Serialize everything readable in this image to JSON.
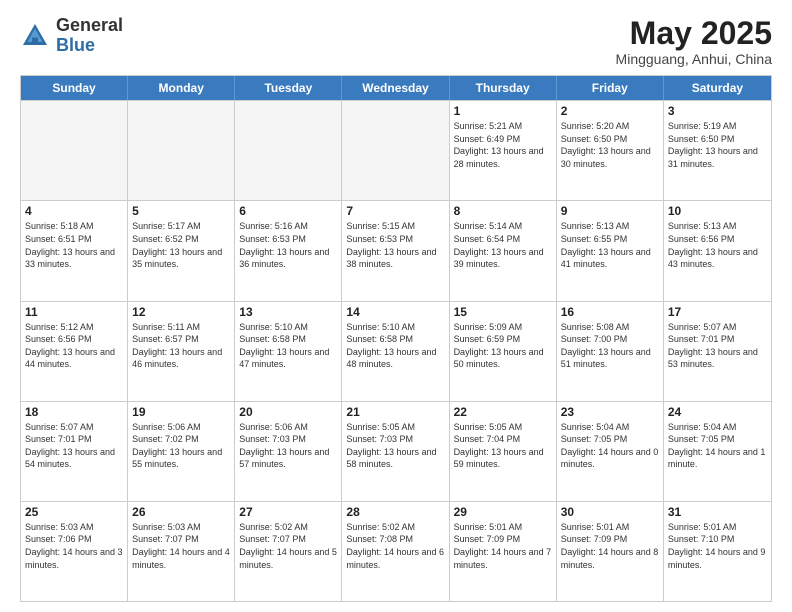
{
  "header": {
    "logo_general": "General",
    "logo_blue": "Blue",
    "month_title": "May 2025",
    "location": "Mingguang, Anhui, China"
  },
  "days_of_week": [
    "Sunday",
    "Monday",
    "Tuesday",
    "Wednesday",
    "Thursday",
    "Friday",
    "Saturday"
  ],
  "weeks": [
    [
      {
        "day": "",
        "info": "",
        "empty": true
      },
      {
        "day": "",
        "info": "",
        "empty": true
      },
      {
        "day": "",
        "info": "",
        "empty": true
      },
      {
        "day": "",
        "info": "",
        "empty": true
      },
      {
        "day": "1",
        "info": "Sunrise: 5:21 AM\nSunset: 6:49 PM\nDaylight: 13 hours\nand 28 minutes.",
        "empty": false
      },
      {
        "day": "2",
        "info": "Sunrise: 5:20 AM\nSunset: 6:50 PM\nDaylight: 13 hours\nand 30 minutes.",
        "empty": false
      },
      {
        "day": "3",
        "info": "Sunrise: 5:19 AM\nSunset: 6:50 PM\nDaylight: 13 hours\nand 31 minutes.",
        "empty": false
      }
    ],
    [
      {
        "day": "4",
        "info": "Sunrise: 5:18 AM\nSunset: 6:51 PM\nDaylight: 13 hours\nand 33 minutes.",
        "empty": false
      },
      {
        "day": "5",
        "info": "Sunrise: 5:17 AM\nSunset: 6:52 PM\nDaylight: 13 hours\nand 35 minutes.",
        "empty": false
      },
      {
        "day": "6",
        "info": "Sunrise: 5:16 AM\nSunset: 6:53 PM\nDaylight: 13 hours\nand 36 minutes.",
        "empty": false
      },
      {
        "day": "7",
        "info": "Sunrise: 5:15 AM\nSunset: 6:53 PM\nDaylight: 13 hours\nand 38 minutes.",
        "empty": false
      },
      {
        "day": "8",
        "info": "Sunrise: 5:14 AM\nSunset: 6:54 PM\nDaylight: 13 hours\nand 39 minutes.",
        "empty": false
      },
      {
        "day": "9",
        "info": "Sunrise: 5:13 AM\nSunset: 6:55 PM\nDaylight: 13 hours\nand 41 minutes.",
        "empty": false
      },
      {
        "day": "10",
        "info": "Sunrise: 5:13 AM\nSunset: 6:56 PM\nDaylight: 13 hours\nand 43 minutes.",
        "empty": false
      }
    ],
    [
      {
        "day": "11",
        "info": "Sunrise: 5:12 AM\nSunset: 6:56 PM\nDaylight: 13 hours\nand 44 minutes.",
        "empty": false
      },
      {
        "day": "12",
        "info": "Sunrise: 5:11 AM\nSunset: 6:57 PM\nDaylight: 13 hours\nand 46 minutes.",
        "empty": false
      },
      {
        "day": "13",
        "info": "Sunrise: 5:10 AM\nSunset: 6:58 PM\nDaylight: 13 hours\nand 47 minutes.",
        "empty": false
      },
      {
        "day": "14",
        "info": "Sunrise: 5:10 AM\nSunset: 6:58 PM\nDaylight: 13 hours\nand 48 minutes.",
        "empty": false
      },
      {
        "day": "15",
        "info": "Sunrise: 5:09 AM\nSunset: 6:59 PM\nDaylight: 13 hours\nand 50 minutes.",
        "empty": false
      },
      {
        "day": "16",
        "info": "Sunrise: 5:08 AM\nSunset: 7:00 PM\nDaylight: 13 hours\nand 51 minutes.",
        "empty": false
      },
      {
        "day": "17",
        "info": "Sunrise: 5:07 AM\nSunset: 7:01 PM\nDaylight: 13 hours\nand 53 minutes.",
        "empty": false
      }
    ],
    [
      {
        "day": "18",
        "info": "Sunrise: 5:07 AM\nSunset: 7:01 PM\nDaylight: 13 hours\nand 54 minutes.",
        "empty": false
      },
      {
        "day": "19",
        "info": "Sunrise: 5:06 AM\nSunset: 7:02 PM\nDaylight: 13 hours\nand 55 minutes.",
        "empty": false
      },
      {
        "day": "20",
        "info": "Sunrise: 5:06 AM\nSunset: 7:03 PM\nDaylight: 13 hours\nand 57 minutes.",
        "empty": false
      },
      {
        "day": "21",
        "info": "Sunrise: 5:05 AM\nSunset: 7:03 PM\nDaylight: 13 hours\nand 58 minutes.",
        "empty": false
      },
      {
        "day": "22",
        "info": "Sunrise: 5:05 AM\nSunset: 7:04 PM\nDaylight: 13 hours\nand 59 minutes.",
        "empty": false
      },
      {
        "day": "23",
        "info": "Sunrise: 5:04 AM\nSunset: 7:05 PM\nDaylight: 14 hours\nand 0 minutes.",
        "empty": false
      },
      {
        "day": "24",
        "info": "Sunrise: 5:04 AM\nSunset: 7:05 PM\nDaylight: 14 hours\nand 1 minute.",
        "empty": false
      }
    ],
    [
      {
        "day": "25",
        "info": "Sunrise: 5:03 AM\nSunset: 7:06 PM\nDaylight: 14 hours\nand 3 minutes.",
        "empty": false
      },
      {
        "day": "26",
        "info": "Sunrise: 5:03 AM\nSunset: 7:07 PM\nDaylight: 14 hours\nand 4 minutes.",
        "empty": false
      },
      {
        "day": "27",
        "info": "Sunrise: 5:02 AM\nSunset: 7:07 PM\nDaylight: 14 hours\nand 5 minutes.",
        "empty": false
      },
      {
        "day": "28",
        "info": "Sunrise: 5:02 AM\nSunset: 7:08 PM\nDaylight: 14 hours\nand 6 minutes.",
        "empty": false
      },
      {
        "day": "29",
        "info": "Sunrise: 5:01 AM\nSunset: 7:09 PM\nDaylight: 14 hours\nand 7 minutes.",
        "empty": false
      },
      {
        "day": "30",
        "info": "Sunrise: 5:01 AM\nSunset: 7:09 PM\nDaylight: 14 hours\nand 8 minutes.",
        "empty": false
      },
      {
        "day": "31",
        "info": "Sunrise: 5:01 AM\nSunset: 7:10 PM\nDaylight: 14 hours\nand 9 minutes.",
        "empty": false
      }
    ]
  ]
}
